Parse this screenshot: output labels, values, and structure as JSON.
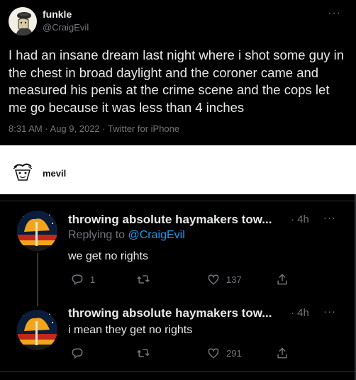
{
  "tweet": {
    "author_name": "funkle",
    "author_handle": "@CraigEvil",
    "text": "I had an insane dream last night where i shot some guy in the chest in broad daylight and the coroner came and measured his penis at the crime scene and the cops let me go because it was less than 4 inches",
    "meta": "8:31 AM · Aug 9, 2022 · Twitter for iPhone",
    "more": "···"
  },
  "quoter": {
    "name": "mevil"
  },
  "replies": [
    {
      "author_name": "throwing absolute haymakers tow...",
      "time": "· 4h",
      "more": "···",
      "replying_prefix": "Replying to ",
      "replying_to": "@CraigEvil",
      "text": "we get no rights",
      "reply_count": "1",
      "like_count": "137"
    },
    {
      "author_name": "throwing absolute haymakers tow...",
      "time": "· 4h",
      "more": "···",
      "text": "i mean they get no rights",
      "reply_count": "",
      "like_count": "291"
    }
  ],
  "colors": {
    "accent": "#1d9bf0",
    "muted": "#71767b",
    "text": "#e7e9ea",
    "background": "#000000"
  }
}
